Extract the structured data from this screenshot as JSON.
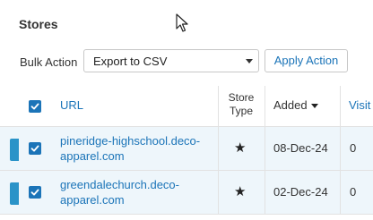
{
  "section": {
    "title": "Stores"
  },
  "bulk_action": {
    "label": "Bulk Action",
    "selected": "Export to CSV",
    "apply_label": "Apply Action"
  },
  "table": {
    "columns": {
      "url": "URL",
      "store_type": "Store Type",
      "added": "Added",
      "visits": "Visit"
    },
    "rows": [
      {
        "url": "pineridge-highschool.deco-apparel.com",
        "store_type": "★",
        "added": "08-Dec-24",
        "visits": "0",
        "selected": true
      },
      {
        "url": "greendalechurch.deco-apparel.com",
        "store_type": "★",
        "added": "02-Dec-24",
        "visits": "0",
        "selected": true
      }
    ]
  },
  "colors": {
    "accent": "#1b74b8",
    "row_highlight": "#eef6fb",
    "row_handle": "#2a93c8"
  }
}
